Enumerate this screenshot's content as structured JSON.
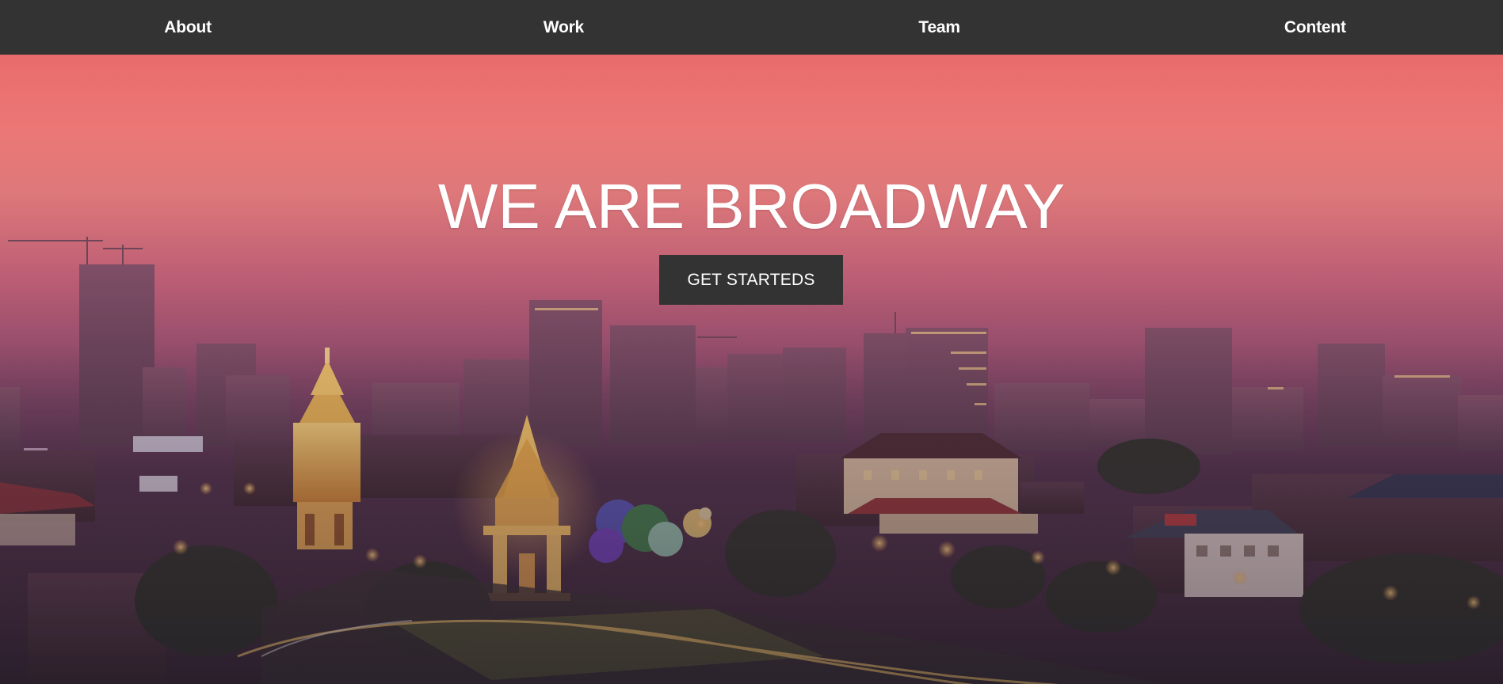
{
  "nav": {
    "items": [
      {
        "label": "About"
      },
      {
        "label": "Work"
      },
      {
        "label": "Team"
      },
      {
        "label": "Content"
      }
    ]
  },
  "hero": {
    "title": "WE ARE BROADWAY",
    "cta_label": "GET STARTEDS",
    "background_image": "night-city-skyline-with-illuminated-monument"
  },
  "colors": {
    "nav_bg": "#333333",
    "nav_text": "#ffffff",
    "hero_title": "#ffffff",
    "button_bg": "#333333",
    "button_text": "#ffffff",
    "sky_top": "#e86b6b",
    "sky_mid": "#c9637a",
    "sky_bottom": "#3f2a44"
  }
}
